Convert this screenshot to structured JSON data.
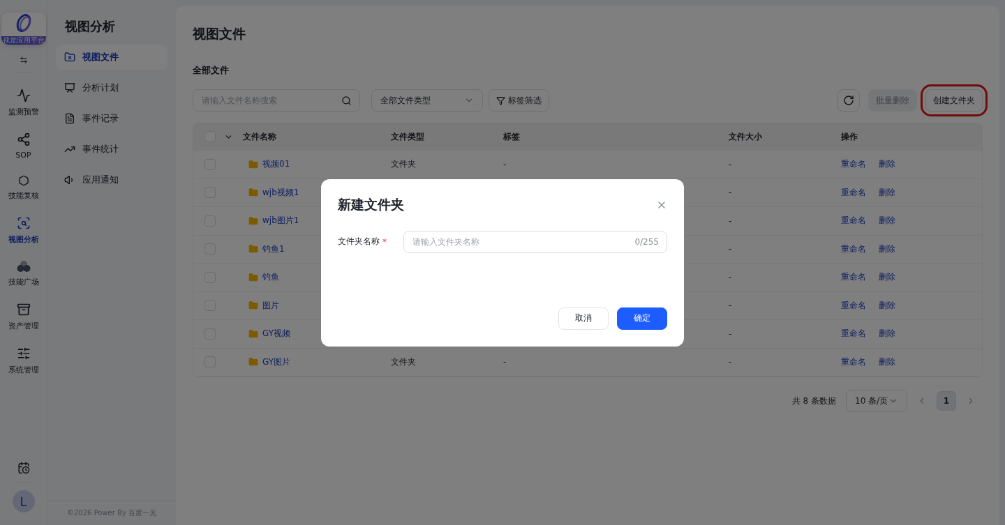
{
  "logo": {
    "caption": "视觉应用平台"
  },
  "rail": [
    {
      "label": "监测预警",
      "selected": false
    },
    {
      "label": "SOP",
      "selected": false
    },
    {
      "label": "技能复核",
      "selected": false
    },
    {
      "label": "视图分析",
      "selected": true
    },
    {
      "label": "技能广场",
      "selected": false
    },
    {
      "label": "资产管理",
      "selected": false
    },
    {
      "label": "系统管理",
      "selected": false
    }
  ],
  "avatar": "L",
  "submenu": {
    "title": "视图分析",
    "items": [
      {
        "label": "视图文件",
        "selected": true
      },
      {
        "label": "分析计划",
        "selected": false
      },
      {
        "label": "事件记录",
        "selected": false
      },
      {
        "label": "事件统计",
        "selected": false
      },
      {
        "label": "应用通知",
        "selected": false
      }
    ]
  },
  "footer": "©2026 Power By 百度一见",
  "page_title": "视图文件",
  "section_title": "全部文件",
  "toolbar": {
    "search_placeholder": "请输入文件名称搜索",
    "type_select": "全部文件类型",
    "tag_filter": "标签筛选",
    "buttons": [
      {
        "label": "批量删除",
        "disabled": true,
        "highlighted": false
      },
      {
        "label": "创建文件夹",
        "disabled": false,
        "highlighted": true
      }
    ]
  },
  "table": {
    "header_checked": false,
    "columns": [
      "文件名称",
      "文件类型",
      "标签",
      "文件大小",
      "操作"
    ],
    "rows": [
      {
        "checked": false,
        "name": "视频01",
        "type": "文件夹",
        "tag": "-",
        "size": "-",
        "actions": [
          "重命名",
          "删除"
        ]
      },
      {
        "checked": false,
        "name": "wjb视频1",
        "size": "-",
        "actions": [
          "重命名",
          "删除"
        ]
      },
      {
        "checked": false,
        "name": "wjb图片1",
        "size": "-",
        "actions": [
          "重命名",
          "删除"
        ]
      },
      {
        "checked": false,
        "name": "钓鱼1",
        "size": "-",
        "actions": [
          "重命名",
          "删除"
        ]
      },
      {
        "checked": false,
        "name": "钓鱼",
        "size": "-",
        "actions": [
          "重命名",
          "删除"
        ]
      },
      {
        "checked": false,
        "name": "图片",
        "size": "-",
        "actions": [
          "重命名",
          "删除"
        ]
      },
      {
        "checked": false,
        "name": "GY视频",
        "size": "-",
        "actions": [
          "重命名",
          "删除"
        ]
      },
      {
        "checked": false,
        "name": "GY图片",
        "type": "文件夹",
        "tag": "-",
        "size": "-",
        "actions": [
          "重命名",
          "删除"
        ]
      }
    ]
  },
  "pagination": {
    "total": "共 8 条数据",
    "page_size": "10 条/页",
    "pages": [
      {
        "label": "1",
        "selected": true
      }
    ]
  },
  "dialog": {
    "title": "新建文件夹",
    "field_label": "文件夹名称",
    "required_mark": "*",
    "placeholder": "请输入文件夹名称",
    "counter": "0/255",
    "cancel": "取消",
    "confirm": "确定"
  }
}
